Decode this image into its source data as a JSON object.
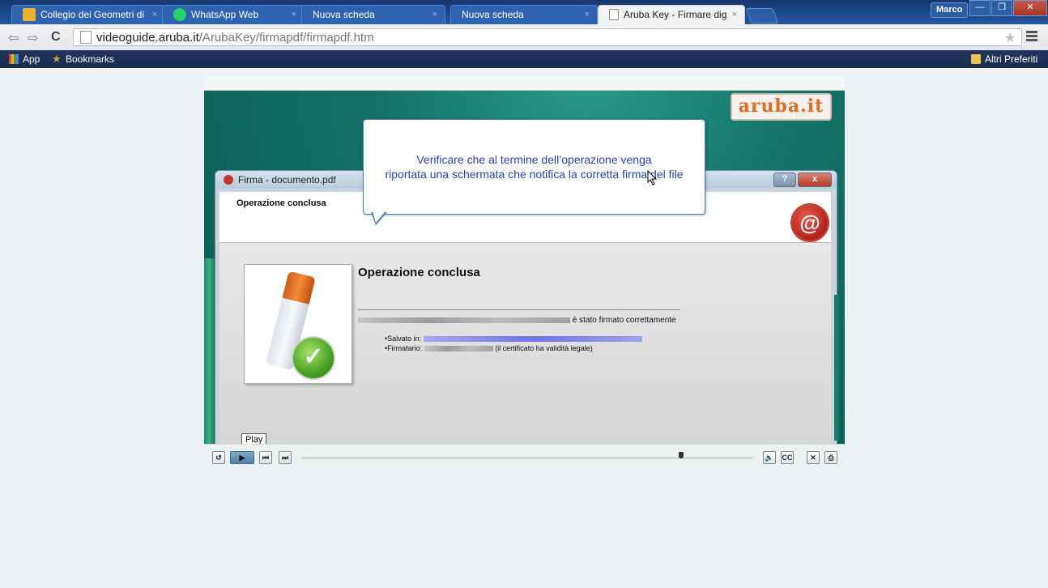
{
  "browser": {
    "tabs": [
      {
        "title": "Collegio dei Geometri di S",
        "close": "×",
        "active": false
      },
      {
        "title": "WhatsApp Web",
        "close": "×",
        "active": false
      },
      {
        "title": "Nuova scheda",
        "close": "×",
        "active": false
      },
      {
        "title": "Nuova scheda",
        "close": "×",
        "active": false
      },
      {
        "title": "Aruba Key - Firmare digita",
        "close": "×",
        "active": true
      }
    ],
    "profile": "Marco",
    "url_host": "videoguide.aruba.it",
    "url_path": "/ArubaKey/firmapdf/firmapdf.htm",
    "bookmarks": {
      "apps": "App",
      "bookmarks": "Bookmarks",
      "other": "Altri Preferiti"
    }
  },
  "player": {
    "logo": "aruba.it",
    "dialog_title": "Firma - documento.pdf",
    "dialog_help": "?",
    "dialog_close": "x",
    "header_title": "Operazione conclusa",
    "body_title": "Operazione conclusa",
    "signed_text": "è stato firmato correttamente",
    "saved_in": "•Salvato in:",
    "signer": "•Firmatario:",
    "legal_note": "(il certificato ha validità legale)",
    "callout_line1": "Verificare che al termine dell’operazione venga",
    "callout_line2": "riportata una schermata che notifica la corretta firma del file",
    "tooltip": "Play",
    "progress": 0.84,
    "icons": {
      "replay": "↺",
      "play": "▶",
      "prev": "⏮",
      "next": "⏭",
      "volume": "🔈",
      "cc": "CC",
      "close": "✕",
      "print": "⎙"
    }
  }
}
